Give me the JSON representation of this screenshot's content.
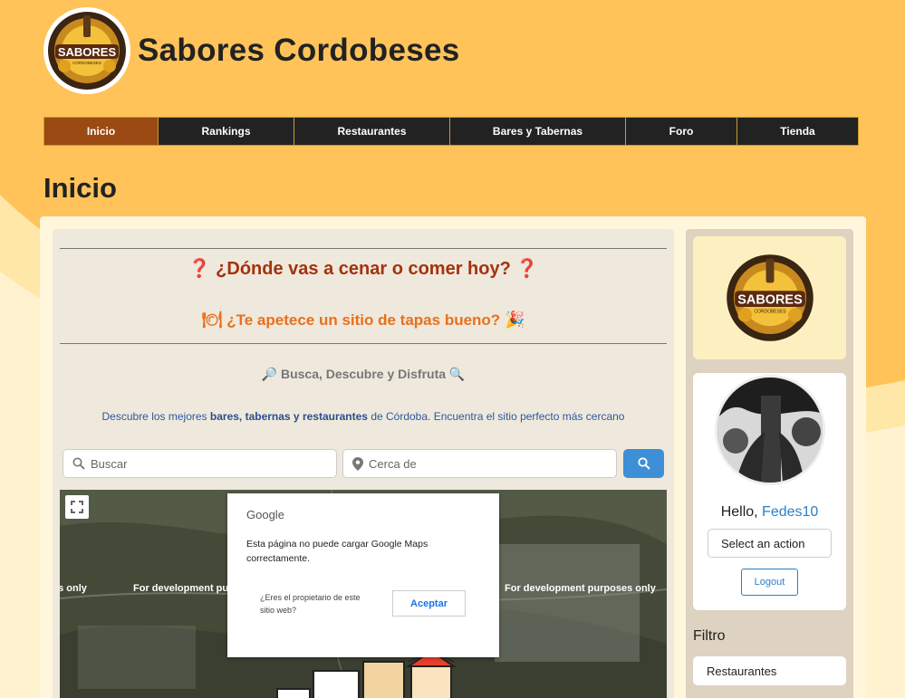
{
  "site": {
    "title": "Sabores Cordobeses",
    "logo_text": "SABORES",
    "logo_subtext": "CORDOBESES"
  },
  "nav": {
    "items": [
      {
        "label": "Inicio",
        "active": true
      },
      {
        "label": "Rankings"
      },
      {
        "label": "Restaurantes"
      },
      {
        "label": "Bares y Tabernas"
      },
      {
        "label": "Foro"
      },
      {
        "label": "Tienda"
      }
    ]
  },
  "page": {
    "heading": "Inicio"
  },
  "hero": {
    "question1": "¿Dónde vas a cenar o comer hoy?",
    "question2": "¿Te apetece un sitio de tapas bueno?",
    "tagline": "Busca, Descubre y Disfruta",
    "description_pre": "Descubre los mejores ",
    "description_bold": "bares, tabernas y restaurantes",
    "description_post": " de Córdoba. Encuentra el sitio perfecto más cercano"
  },
  "search": {
    "query_placeholder": "Buscar",
    "near_placeholder": "Cerca de"
  },
  "map": {
    "dev_text_left": "es only",
    "dev_text_mid": "For development pur",
    "dev_text_right": "For development purposes only",
    "dialog": {
      "brand": "Google",
      "message": "Esta página no puede cargar Google Maps correctamente.",
      "owner_question": "¿Eres el propietario de este sitio web?",
      "accept_label": "Aceptar"
    }
  },
  "sidebar": {
    "hello": "Hello,",
    "username": "Fedes10",
    "action_select": "Select an action",
    "logout_label": "Logout",
    "filter_label": "Filtro",
    "filter_items": [
      "Restaurantes"
    ]
  },
  "colors": {
    "nav_active": "#9a4a12",
    "question1": "#a3320f",
    "question2": "#e8701c",
    "link": "#2a7fc8",
    "search_button": "#3d8fd6"
  }
}
